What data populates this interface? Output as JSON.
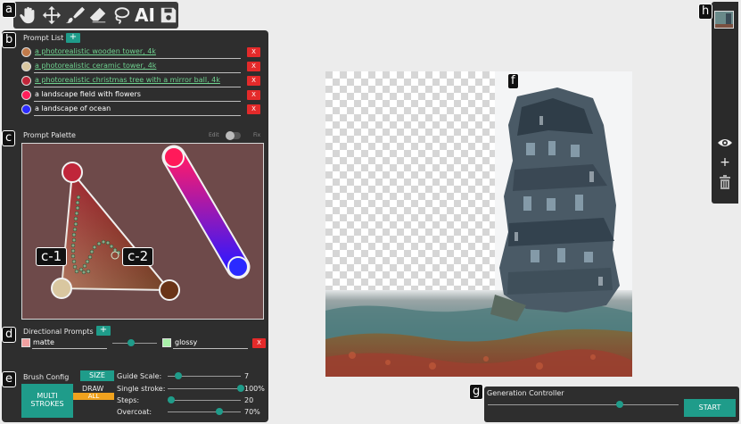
{
  "badges": {
    "a": "a",
    "b": "b",
    "c": "c",
    "d": "d",
    "e": "e",
    "f": "f",
    "g": "g",
    "h": "h",
    "c1": "c-1",
    "c2": "c-2"
  },
  "toolbar": {
    "tools": [
      "hand-icon",
      "move-icon",
      "brush-icon",
      "eraser-icon",
      "lasso-icon"
    ],
    "ai_label": "AI"
  },
  "prompt_list": {
    "title": "Prompt List",
    "add_label": "+",
    "items": [
      {
        "text": "a photorealistic wooden tower, 4k",
        "color": "#c07a4a",
        "text_color": "#6fd08f"
      },
      {
        "text": "a photorealistic ceramic tower, 4k",
        "color": "#d9c7a0",
        "text_color": "#6fd08f"
      },
      {
        "text": "a photorealistic christmas tree with a mirror ball, 4k",
        "color": "#c0263a",
        "text_color": "#6fd08f"
      },
      {
        "text": "a landscape field with flowers",
        "color": "#ff1f5a",
        "text_color": "#ffffff"
      },
      {
        "text": "a landscape of ocean",
        "color": "#2b2bff",
        "text_color": "#ffffff"
      }
    ],
    "remove_label": "X"
  },
  "prompt_palette": {
    "title": "Prompt Palette",
    "mode_left": "Edit",
    "mode_right": "Fix"
  },
  "directional_prompts": {
    "title": "Directional Prompts",
    "add_label": "+",
    "left_word": "matte",
    "left_color": "#f0a0a0",
    "right_word": "glossy",
    "right_color": "#a8f0a8",
    "slider_value": 0.5,
    "remove_label": "X"
  },
  "brush_config": {
    "title": "Brush Config",
    "size_label": "SIZE",
    "draw_label": "DRAW",
    "all_label": "ALL",
    "multi_label": "MULTI STROKES",
    "params": [
      {
        "label": "Guide Scale:",
        "value": "7",
        "fraction": 0.1
      },
      {
        "label": "Single stroke:",
        "value": "100%",
        "fraction": 1.0
      },
      {
        "label": "Steps:",
        "value": "20",
        "fraction": 0.05
      },
      {
        "label": "Overcoat:",
        "value": "70%",
        "fraction": 0.7
      }
    ]
  },
  "generation_controller": {
    "title": "Generation Controller",
    "start_label": "START",
    "slider_value": 0.65
  },
  "colors": {
    "teal": "#1f9c8a",
    "red": "#e42a2a",
    "panel": "#2e2e2e"
  }
}
